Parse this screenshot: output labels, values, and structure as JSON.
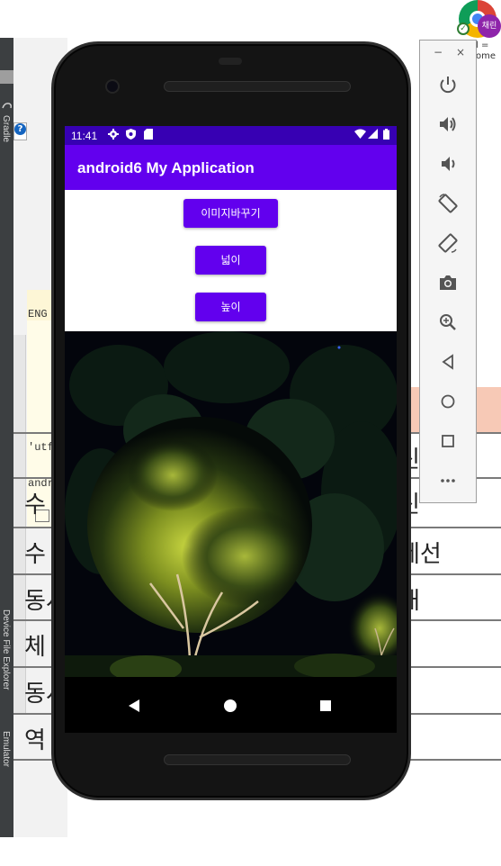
{
  "background": {
    "ide": {
      "gradle_label": "Gradle",
      "device_file_explorer_label": "Device File Explorer",
      "emulator_label": "Emulator",
      "code_fragments": [
        "ENG",
        "'utf-",
        "andr"
      ]
    },
    "document": {
      "rows": [
        {
          "left": "",
          "right": "신"
        },
        {
          "left": "수",
          "right": "신"
        },
        {
          "left": "수",
          "right": "세선"
        },
        {
          "left": "동시",
          "right": "재"
        },
        {
          "left": "체",
          "right": ""
        },
        {
          "left": "동시",
          "right": ""
        },
        {
          "left": "역",
          "right": ""
        }
      ]
    },
    "chrome": {
      "profile_initials": "채린",
      "label_line1": "l =",
      "label_line2": "ome"
    }
  },
  "phone": {
    "status_bar": {
      "time": "11:41",
      "icons": [
        "settings-icon",
        "shield-icon",
        "sd-card-icon",
        "wifi-icon",
        "signal-icon",
        "battery-icon"
      ],
      "color": "#3700b3"
    },
    "app_bar": {
      "title": "android6 My Application",
      "color": "#6200ee"
    },
    "buttons": {
      "change_image": "이미지바꾸기",
      "width": "넓이",
      "height": "높이"
    },
    "nav_bar": [
      "back-icon",
      "home-icon",
      "recents-icon"
    ]
  },
  "emulator_panel": {
    "window_controls": {
      "minimize": "−",
      "close": "×"
    },
    "buttons": [
      "power-icon",
      "volume-up-icon",
      "volume-down-icon",
      "rotate-left-icon",
      "rotate-right-icon",
      "camera-icon",
      "zoom-icon",
      "back-icon",
      "home-icon",
      "overview-icon",
      "more-icon"
    ]
  }
}
